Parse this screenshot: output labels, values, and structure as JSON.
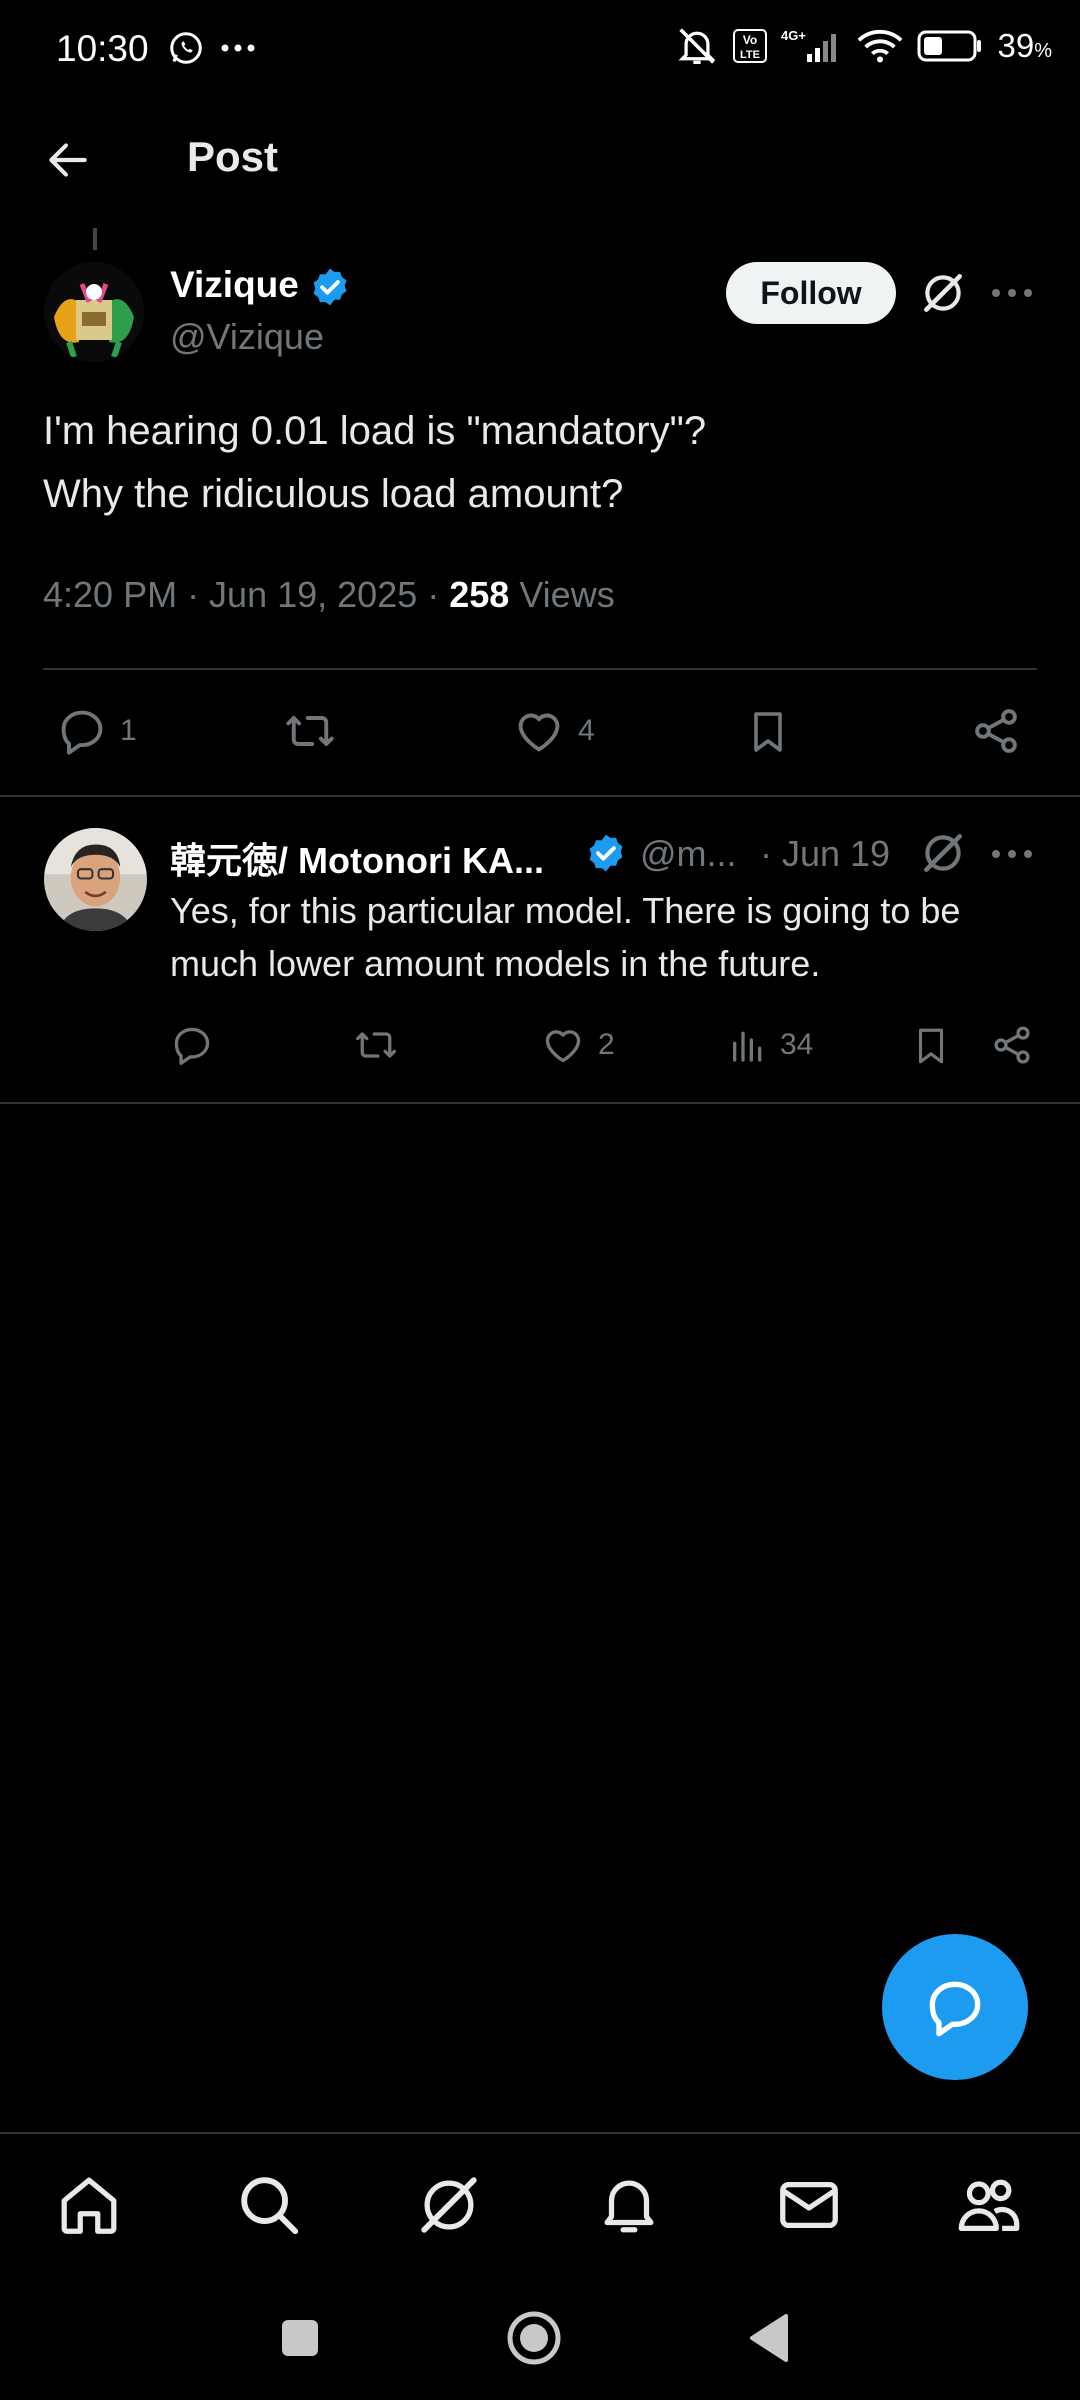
{
  "status_bar": {
    "time": "10:30",
    "network": "4G+",
    "volte": "Vo LTE",
    "battery_percent": "39",
    "battery_unit": "%"
  },
  "header": {
    "title": "Post"
  },
  "post": {
    "author_name": "Vizique",
    "author_handle": "@Vizique",
    "follow_label": "Follow",
    "text": "I'm hearing 0.01 load is \"mandatory\"?\nWhy the ridiculous load amount?",
    "time": "4:20 PM · Jun 19, 2025 · ",
    "views_count": "258",
    "views_label": " Views",
    "actions": {
      "replies": "1",
      "reposts": "",
      "likes": "4"
    }
  },
  "reply": {
    "author_name": "韓元徳/ Motonori KA...",
    "author_handle": "@m...",
    "date": "· Jun 19",
    "text": "Yes, for this particular model. There is going to be much lower amount models in the future.",
    "actions": {
      "replies": "",
      "reposts": "",
      "likes": "2",
      "views": "34"
    }
  },
  "colors": {
    "accent": "#1d9bf0",
    "background": "#000000",
    "muted": "#71767b",
    "divider": "#2f3336"
  }
}
